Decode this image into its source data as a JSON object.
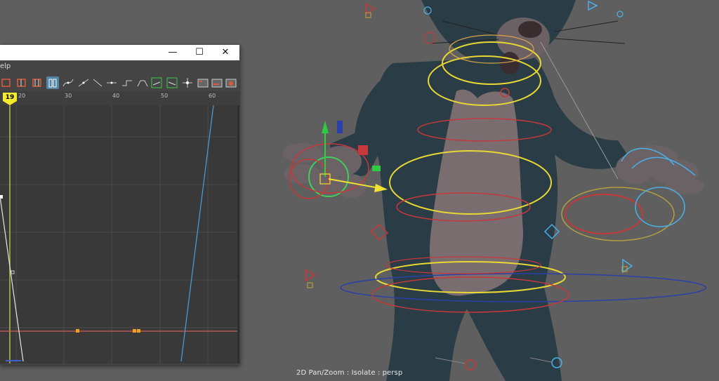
{
  "graph_editor": {
    "menu_help": "elp",
    "current_frame": "19",
    "timeline_ticks": [
      "20",
      "30",
      "40",
      "50",
      "60"
    ],
    "window_controls": {
      "minimize": "—",
      "maximize": "☐",
      "close": "✕"
    },
    "toolbar": {
      "tools": [
        "frame-all",
        "frame-selection",
        "frame-playback",
        "normalize-curves",
        "spline-tangents",
        "clamped-tangents",
        "linear-tangents",
        "flat-tangents",
        "step-tangents",
        "plateau-tangents",
        "buffer-curve-snapshot",
        "swap-buffer",
        "lattice-deform",
        "dope-sheet",
        "trax-editor",
        "time-editor"
      ],
      "active_tool": "normalize-curves"
    },
    "curve_colors": {
      "red": "#d25c55",
      "blue": "#4a9fe0",
      "white": "#e6e6e6",
      "playhead": "#b0c03a"
    }
  },
  "viewport": {
    "hud_label": "2D Pan/Zoom : Isolate : persp",
    "background_color": "#5f5f5f"
  }
}
